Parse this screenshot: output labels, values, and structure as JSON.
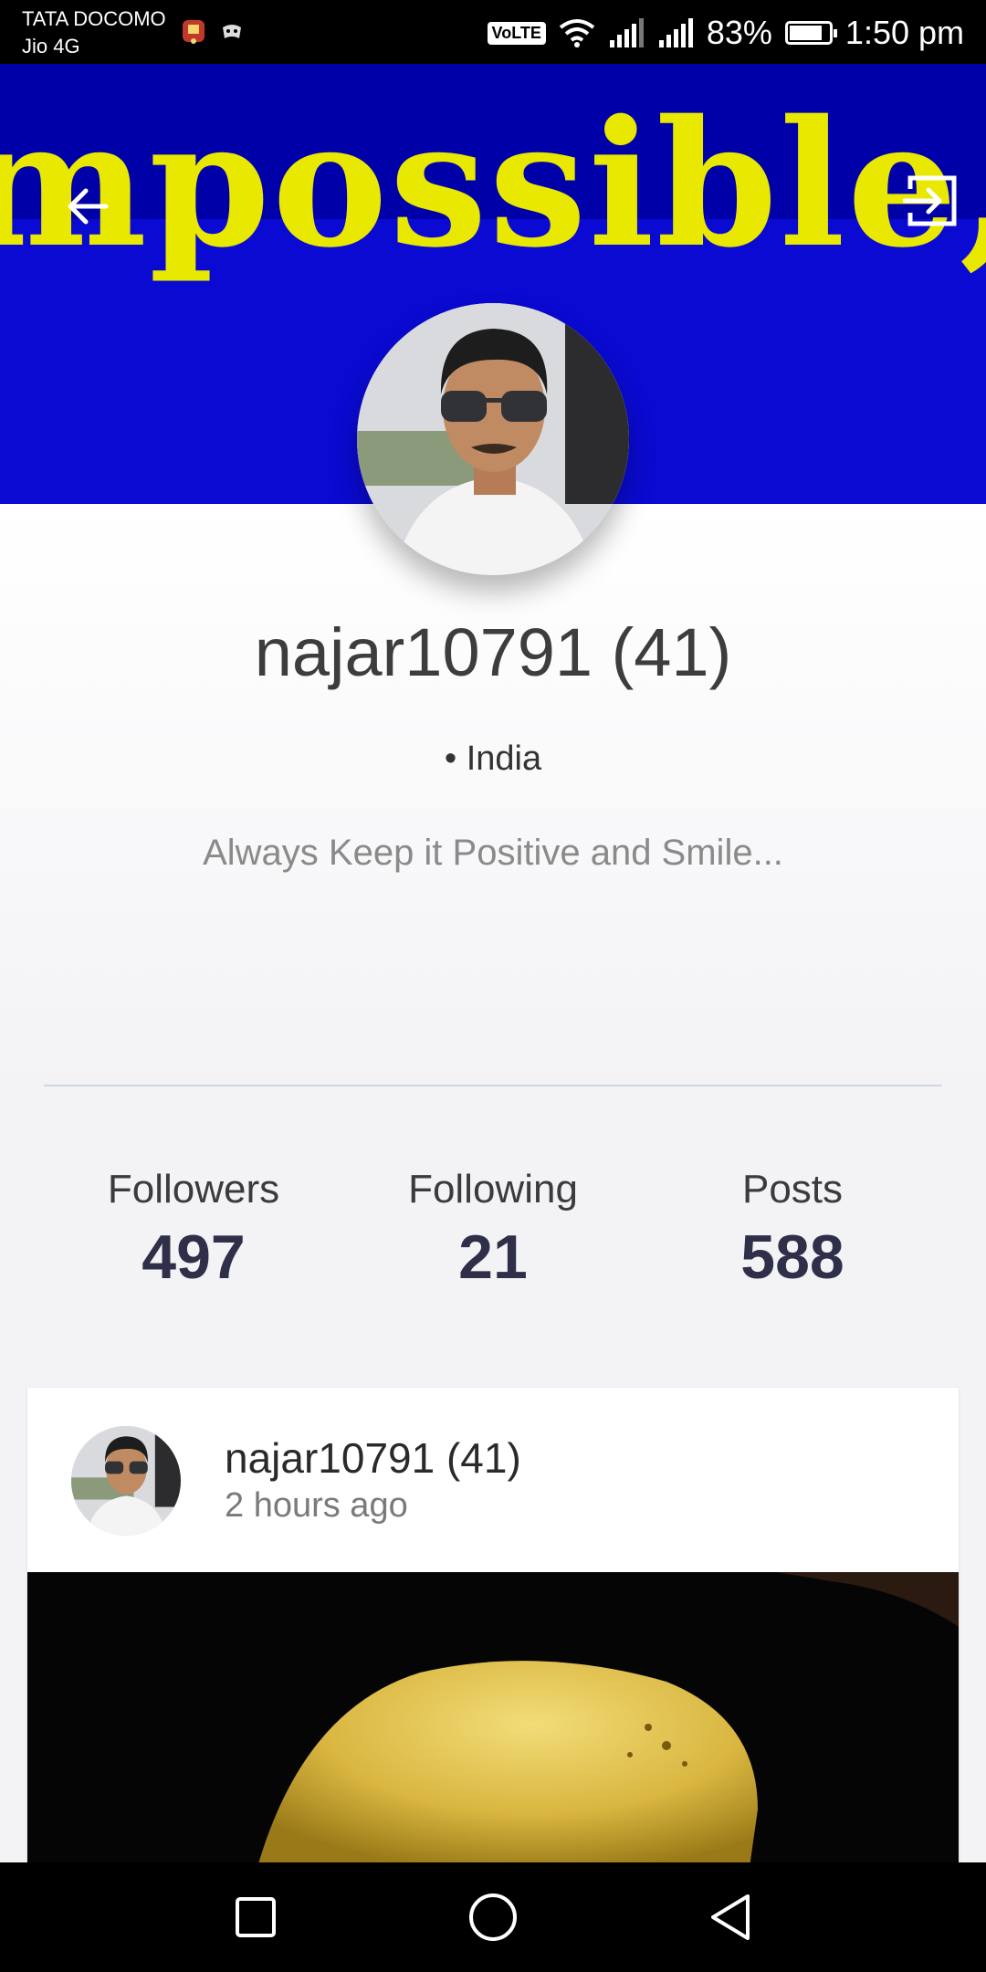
{
  "status_bar": {
    "carrier_primary": "TATA DOCOMO",
    "carrier_secondary": "Jio 4G",
    "volte": "VoLTE",
    "battery_percent": "83%",
    "battery_level": 0.83,
    "time": "1:50 pm"
  },
  "banner": {
    "text": "mpossible, you",
    "background_color": "#0a0ad2",
    "text_color": "#e8e800"
  },
  "header": {
    "back_icon": "arrow-left-icon",
    "exit_icon": "exit-to-app-icon"
  },
  "profile": {
    "username": "najar10791 (41)",
    "location": "• India",
    "bio": "Always Keep it Positive and Smile..."
  },
  "stats": [
    {
      "label": "Followers",
      "value": "497"
    },
    {
      "label": "Following",
      "value": "21"
    },
    {
      "label": "Posts",
      "value": "588"
    }
  ],
  "post": {
    "author": "najar10791 (41)",
    "time": "2 hours ago"
  },
  "nav": {
    "recents_icon": "square-icon",
    "home_icon": "circle-icon",
    "back_icon": "triangle-back-icon"
  }
}
